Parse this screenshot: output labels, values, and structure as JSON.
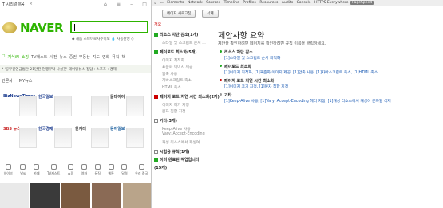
{
  "browser": {
    "tab_label": "T 시리얼결음",
    "tab_close": "×",
    "nav_icons": [
      "home-icon",
      "menu-icon",
      "minimize-icon",
      "maximize-icon"
    ]
  },
  "naver": {
    "logo": "NAVER",
    "search_value": "",
    "search_sub": "◆ 새롭 조브이로자주이보   💧 자동완성 ◇",
    "gnb": [
      "☐",
      "지식iN",
      "쇼핑",
      "TV캐스트",
      "사전",
      "뉴스",
      "증권",
      "부동산",
      "지도",
      "영화",
      "뮤직",
      "책"
    ],
    "strip_text": "* '공무원연금법안 21만전 언행부탁 나설것'     데이팅뉴스  정답 : 스포츠 : 경제",
    "press_tabs": [
      "언론사",
      "MY뉴스"
    ],
    "press_logos": [
      "BizNewsTimes",
      "한국일보",
      "",
      "물대아이",
      "SBS 뉴스",
      "한국경제",
      "한겨레",
      "동아일보"
    ],
    "press_logo_colors": [
      "#1d3d8f",
      "#1d3d8f",
      "#222",
      "#333",
      "#c33",
      "#1d3d8f",
      "#333",
      "#1c5f9e"
    ],
    "icon_labels": [
      "하이브",
      "날씨",
      "카페",
      "TV캐스트",
      "쇼핑",
      "영화",
      "뮤직",
      "웹툰",
      "달력",
      "우리 중국"
    ]
  },
  "devtools": {
    "tabs": [
      "Elements",
      "Network",
      "Sources",
      "Timeline",
      "Profiles",
      "Resources",
      "Audits",
      "Console",
      "HTTPS Everywhere",
      "PageSpeed"
    ],
    "selected_tab": "PageSpeed",
    "buttons": {
      "refresh": "페이지 새로고침",
      "clear": "삭제"
    },
    "sidebar": {
      "summary": "개요",
      "items": [
        {
          "label": "리소스 차단 감소(1개)",
          "status": "green",
          "bold": true
        },
        {
          "label": "스타일 및 스크립트 순서 ...",
          "sub": true
        },
        {
          "label": "페이로드 최소화(5개)",
          "status": "green",
          "bold": true
        },
        {
          "label": "이미지 최적화",
          "sub": true
        },
        {
          "label": "표준화 이미지 제공",
          "sub": true
        },
        {
          "label": "압축 사용",
          "sub": true
        },
        {
          "label": "자바스크립트 축소",
          "sub": true
        },
        {
          "label": "HTML 축소",
          "sub": true
        },
        {
          "label": "페이지 로드 지연 시간 최소화(2개)",
          "status": "red",
          "bold": true
        },
        {
          "label": "이미지 여기 지정",
          "sub": true
        },
        {
          "label": "문자 집합 지정",
          "sub": true
        },
        {
          "label": "기타(3개)",
          "status": "white",
          "bold": true
        },
        {
          "label": "Keep-Alive 사용",
          "sub": true
        },
        {
          "label": "Vary: Accept-Encoding",
          "sub": true
        },
        {
          "label": "캐싱 리소스에서 캐싱여 ...",
          "sub": true
        },
        {
          "label": "시험용 규칙(1개)",
          "status": "white",
          "bold": true
        },
        {
          "label": "이미 완료된 작업입니다.",
          "status": "green",
          "bold": true
        },
        {
          "label": "(15개)",
          "bold": true
        }
      ]
    },
    "content": {
      "title": "제안사항 요약",
      "desc": "제안을 확인하려면 페이지를 확인하려면 규칙 이름을 클릭하세요.",
      "results": [
        {
          "title": "리소스 차단 감소",
          "dot": "#2a2",
          "detail": [
            "[1]스타일 및 스크립트 순서 최적화"
          ]
        },
        {
          "title": "페이로드 최소화",
          "dot": "#2a2",
          "detail": [
            "[1]이미지 최적화, [1]표준화 이미지 제공, [1]압축 사용, [1]자바스크립트 축소, [1]HTML 축소"
          ]
        },
        {
          "title": "페이지 로드 지연 시간 최소화",
          "dot": "#c00",
          "detail": [
            "[1]이미지 크기 지정, [1]문자 집합 지정"
          ]
        },
        {
          "title": "기타",
          "dot": "#999",
          "detail": [
            "[1]Keep-Alive 사용, [1]Vary: Accept-Encoding 헤더 지정, [1]캐싱 리소스에서 캐싱어 문자열 삭제"
          ]
        }
      ]
    }
  }
}
